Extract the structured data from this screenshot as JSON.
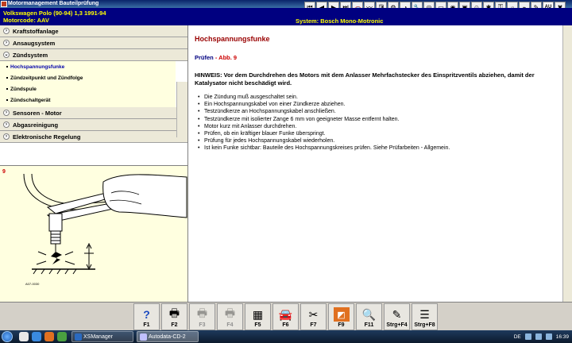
{
  "window": {
    "title": "Motormanagement Bauteilprüfung"
  },
  "vehicle": {
    "model_line": "Volkswagen   Polo (90-94) 1,3   1991-94",
    "motorcode_line": "Motorcode: AAV",
    "system": "System: Bosch Mono-Motronic"
  },
  "toolbar": {
    "au_label": "AU"
  },
  "menu": {
    "items": [
      {
        "label": "Kraftstoffanlage"
      },
      {
        "label": "Ansaugsystem"
      },
      {
        "label": "Zündsystem"
      }
    ],
    "sub_items": [
      {
        "label": "Hochspannungsfunke"
      },
      {
        "label": "Zündzeitpunkt und Zündfolge"
      },
      {
        "label": "Zündspule"
      },
      {
        "label": "Zündschaltgerät"
      }
    ],
    "items_after": [
      {
        "label": "Sensoren - Motor"
      },
      {
        "label": "Abgasreinigung"
      },
      {
        "label": "Elektronische Regelung"
      }
    ]
  },
  "illustration": {
    "number": "9",
    "caption": "A07-0030"
  },
  "content": {
    "title": "Hochspannungsfunke",
    "pruefen": "Prüfen",
    "abb": " - Abb. 9",
    "hinweis": "HINWEIS: Vor dem Durchdrehen des Motors mit dem Anlasser Mehrfachstecker des Einspritzventils abziehen, damit der Katalysator nicht beschädigt wird.",
    "steps": [
      "Die Zündung muß ausgeschaltet sein.",
      "Ein Hochspannungskabel von einer Zündkerze abziehen.",
      "Testzündkerze an Hochspannungskabel anschließen.",
      "Testzündkerze mit isolierter Zange 6 mm von geeigneter Masse entfernt halten.",
      "Motor kurz mit Anlasser durchdrehen.",
      "Prüfen, ob ein kräftiger blauer Funke überspringt.",
      "Prüfung für jedes Hochspannungskabel wiederholen.",
      "Ist kein Funke sichtbar: Bauteile des Hochspannungskreises prüfen. Siehe Prüfarbeiten - Allgemein."
    ]
  },
  "fkeys": [
    {
      "label": "F1",
      "icon": "help-icon",
      "enabled": true
    },
    {
      "label": "F2",
      "icon": "print-icon",
      "enabled": true
    },
    {
      "label": "F3",
      "icon": "print-icon",
      "enabled": false
    },
    {
      "label": "F4",
      "icon": "print-icon",
      "enabled": false
    },
    {
      "label": "F5",
      "icon": "document-icon",
      "enabled": true
    },
    {
      "label": "F6",
      "icon": "car-icon",
      "enabled": true
    },
    {
      "label": "F7",
      "icon": "tools-icon",
      "enabled": true
    },
    {
      "label": "F9",
      "icon": "image-icon",
      "enabled": true
    },
    {
      "label": "F11",
      "icon": "search-icon",
      "enabled": true
    },
    {
      "label": "Strg+F4",
      "icon": "edit-icon",
      "enabled": true
    },
    {
      "label": "Strg+F8",
      "icon": "list-icon",
      "enabled": true
    }
  ],
  "taskbar": {
    "tasks": [
      {
        "label": "XSManager"
      },
      {
        "label": "Autodata-CD-2"
      }
    ],
    "lang": "DE",
    "time": "16:39"
  }
}
